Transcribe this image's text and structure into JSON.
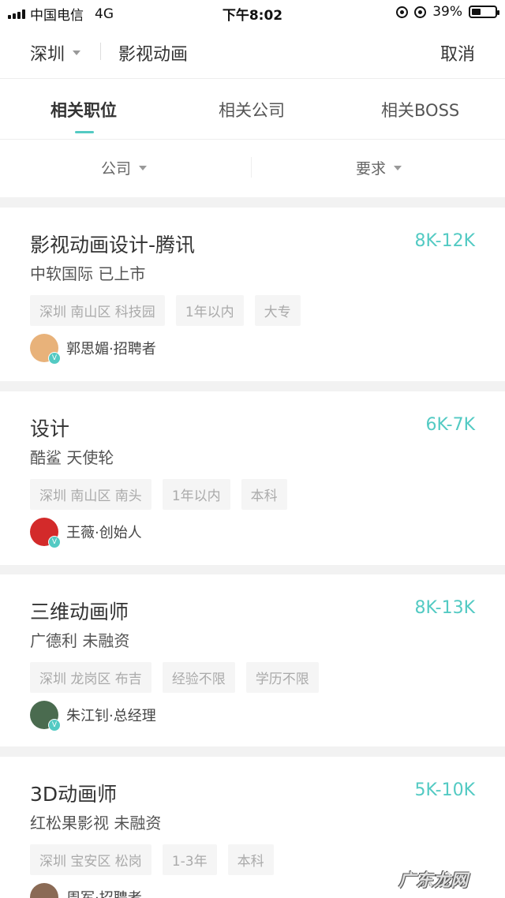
{
  "status_bar": {
    "carrier": "中国电信",
    "network": "4G",
    "time": "下午8:02",
    "battery_percent": "39%",
    "battery_level": 0.39
  },
  "header": {
    "city": "深圳",
    "query": "影视动画",
    "cancel": "取消"
  },
  "tabs": [
    {
      "label": "相关职位",
      "active": true
    },
    {
      "label": "相关公司",
      "active": false
    },
    {
      "label": "相关BOSS",
      "active": false
    }
  ],
  "filters": [
    {
      "label": "公司"
    },
    {
      "label": "要求"
    }
  ],
  "jobs": [
    {
      "title": "影视动画设计-腾讯",
      "salary": "8K-12K",
      "company": "中软国际  已上市",
      "tags": [
        "深圳 南山区 科技园",
        "1年以内",
        "大专"
      ],
      "recruiter": "郭思媚·招聘者",
      "avatar_color": "#e8b27a"
    },
    {
      "title": "设计",
      "salary": "6K-7K",
      "company": "酷鲨  天使轮",
      "tags": [
        "深圳 南山区 南头",
        "1年以内",
        "本科"
      ],
      "recruiter": "王薇·创始人",
      "avatar_color": "#d32a2a"
    },
    {
      "title": "三维动画师",
      "salary": "8K-13K",
      "company": "广德利  未融资",
      "tags": [
        "深圳 龙岗区 布吉",
        "经验不限",
        "学历不限"
      ],
      "recruiter": "朱江钊·总经理",
      "avatar_color": "#4a6b4f"
    },
    {
      "title": "3D动画师",
      "salary": "5K-10K",
      "company": "红松果影视  未融资",
      "tags": [
        "深圳 宝安区 松岗",
        "1-3年",
        "本科"
      ],
      "recruiter": "周军·招聘者",
      "avatar_color": "#8a6a55"
    }
  ],
  "colors": {
    "accent": "#53cac3"
  },
  "watermark": "广东龙网"
}
